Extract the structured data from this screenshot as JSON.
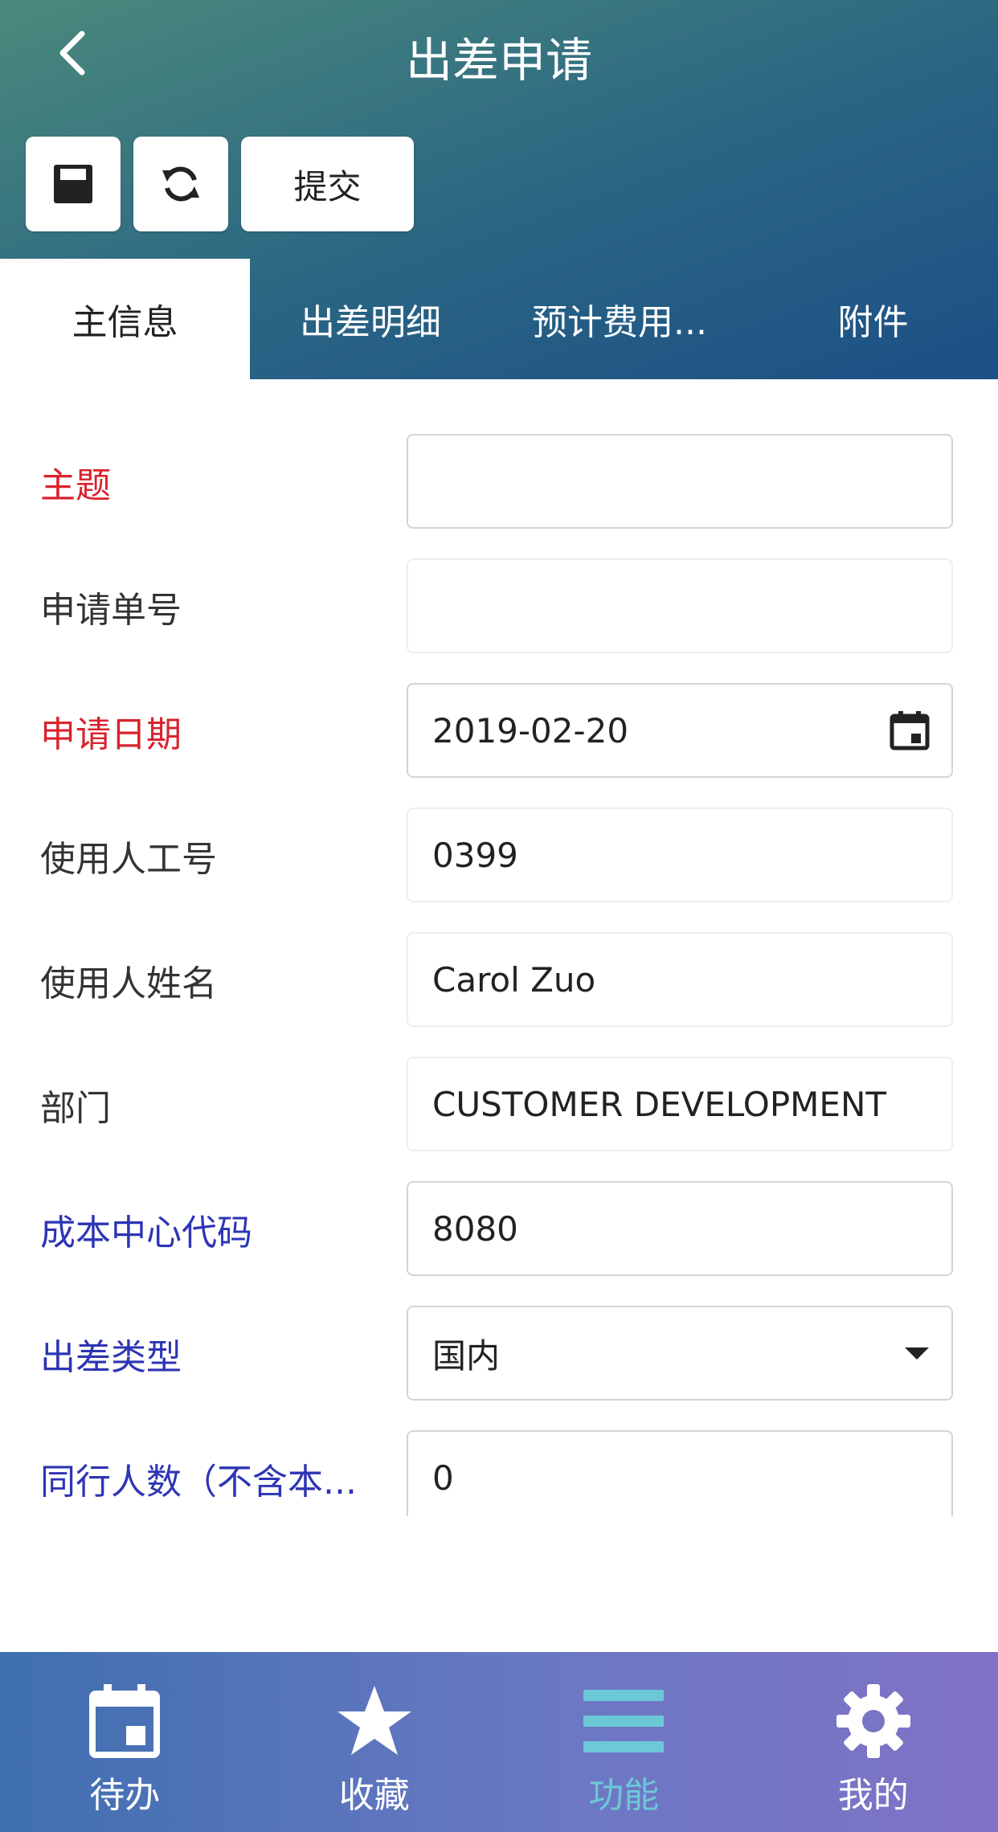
{
  "colors": {
    "header_start": "#4a8a7c",
    "header_mid": "#2a6583",
    "header_end": "#1c4f86",
    "bar_start": "#3f6fb0",
    "bar_mid": "#6a78c4",
    "bar_end": "#8072c6",
    "active_tab": "#6cc8d6",
    "required_label": "#d9232e",
    "blue_label": "#2d35b5"
  },
  "header": {
    "title": "出差申请",
    "back_icon": "chevron-left-icon"
  },
  "toolbar": {
    "save_icon": "save-icon",
    "refresh_icon": "refresh-icon",
    "submit_label": "提交"
  },
  "tabs": [
    {
      "label": "主信息",
      "active": true
    },
    {
      "label": "出差明细",
      "active": false
    },
    {
      "label": "预计费用...",
      "active": false
    },
    {
      "label": "附件",
      "active": false
    }
  ],
  "form": {
    "fields": [
      {
        "label": "主题",
        "value": "",
        "style": "required"
      },
      {
        "label": "申请单号",
        "value": "",
        "style": "normal"
      },
      {
        "label": "申请日期",
        "value": "2019-02-20",
        "style": "required",
        "icon": "calendar-icon"
      },
      {
        "label": "使用人工号",
        "value": "0399",
        "style": "normal"
      },
      {
        "label": "使用人姓名",
        "value": "Carol Zuo",
        "style": "normal"
      },
      {
        "label": "部门",
        "value": "CUSTOMER DEVELOPMENT",
        "style": "normal"
      },
      {
        "label": "成本中心代码",
        "value": "8080",
        "style": "blue"
      },
      {
        "label": "出差类型",
        "value": "国内",
        "style": "blue",
        "icon": "dropdown-arrow-icon"
      },
      {
        "label": "同行人数（不含本...",
        "value": "0",
        "style": "blue"
      }
    ]
  },
  "tabbar": {
    "items": [
      {
        "label": "待办",
        "icon": "calendar-icon"
      },
      {
        "label": "收藏",
        "icon": "star-icon"
      },
      {
        "label": "功能",
        "icon": "menu-icon",
        "active": true
      },
      {
        "label": "我的",
        "icon": "gear-icon"
      }
    ]
  }
}
